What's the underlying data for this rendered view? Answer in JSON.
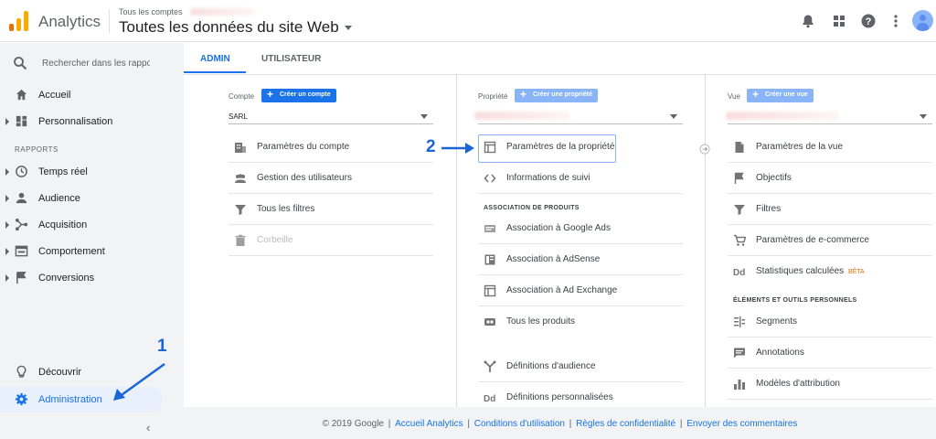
{
  "header": {
    "app_title": "Analytics",
    "account_small": "Tous les comptes",
    "account_main": "Toutes les données du site Web"
  },
  "sidebar": {
    "search_placeholder": "Rechercher dans les rapport",
    "items_top": [
      {
        "label": "Accueil",
        "icon": "home-icon"
      },
      {
        "label": "Personnalisation",
        "icon": "dashboard-icon"
      }
    ],
    "section_label": "RAPPORTS",
    "reports": [
      {
        "label": "Temps réel",
        "icon": "clock-icon"
      },
      {
        "label": "Audience",
        "icon": "person-icon"
      },
      {
        "label": "Acquisition",
        "icon": "acquisition-icon"
      },
      {
        "label": "Comportement",
        "icon": "behavior-icon"
      },
      {
        "label": "Conversions",
        "icon": "flag-icon"
      }
    ],
    "bottom": [
      {
        "label": "Découvrir",
        "icon": "lightbulb-icon"
      },
      {
        "label": "Administration",
        "icon": "gear-icon"
      }
    ]
  },
  "tabs": [
    "ADMIN",
    "UTILISATEUR"
  ],
  "columns": {
    "account": {
      "label": "Compte",
      "button": "Créer un compte",
      "selected": "SARL",
      "items": [
        {
          "label": "Paramètres du compte",
          "icon": "building-icon"
        },
        {
          "label": "Gestion des utilisateurs",
          "icon": "users-icon"
        },
        {
          "label": "Tous les filtres",
          "icon": "filter-icon"
        },
        {
          "label": "Corbeille",
          "icon": "trash-icon"
        }
      ]
    },
    "property": {
      "label": "Propriété",
      "button": "Créer une propriété",
      "items_top": [
        {
          "label": "Paramètres de la propriété",
          "icon": "window-icon"
        },
        {
          "label": "Informations de suivi",
          "icon": "code-icon"
        }
      ],
      "section": "ASSOCIATION DE PRODUITS",
      "items_products": [
        {
          "label": "Association à Google Ads",
          "icon": "ads-icon"
        },
        {
          "label": "Association à AdSense",
          "icon": "adsense-icon"
        },
        {
          "label": "Association à Ad Exchange",
          "icon": "adexchange-icon"
        },
        {
          "label": "Tous les produits",
          "icon": "products-icon"
        }
      ],
      "items_bottom": [
        {
          "label": "Définitions d'audience",
          "icon": "audience-def-icon"
        },
        {
          "label": "Définitions personnalisées",
          "icon": "dd-icon"
        }
      ]
    },
    "view": {
      "label": "Vue",
      "button": "Créer une vue",
      "items_top": [
        {
          "label": "Paramètres de la vue",
          "icon": "doc-icon"
        },
        {
          "label": "Objectifs",
          "icon": "flag-icon"
        },
        {
          "label": "Filtres",
          "icon": "filter-icon"
        },
        {
          "label": "Paramètres de e-commerce",
          "icon": "cart-icon"
        },
        {
          "label": "Statistiques calculées",
          "icon": "dd-icon",
          "badge": "BÊTA"
        }
      ],
      "section": "ÉLÉMENTS ET OUTILS PERSONNELS",
      "items_personal": [
        {
          "label": "Segments",
          "icon": "segments-icon"
        },
        {
          "label": "Annotations",
          "icon": "comment-icon"
        },
        {
          "label": "Modèles d'attribution",
          "icon": "bars-icon"
        }
      ]
    }
  },
  "footer": {
    "copyright": "© 2019 Google",
    "links": [
      "Accueil Analytics",
      "Conditions d'utilisation",
      "Règles de confidentialité",
      "Envoyer des commentaires"
    ]
  },
  "annotations": {
    "step1": "1",
    "step2": "2"
  },
  "colors": {
    "accent": "#1a73e8",
    "annotation": "#1a66d8",
    "logo_orange": "#f9ab00",
    "logo_dark_orange": "#e37400"
  }
}
